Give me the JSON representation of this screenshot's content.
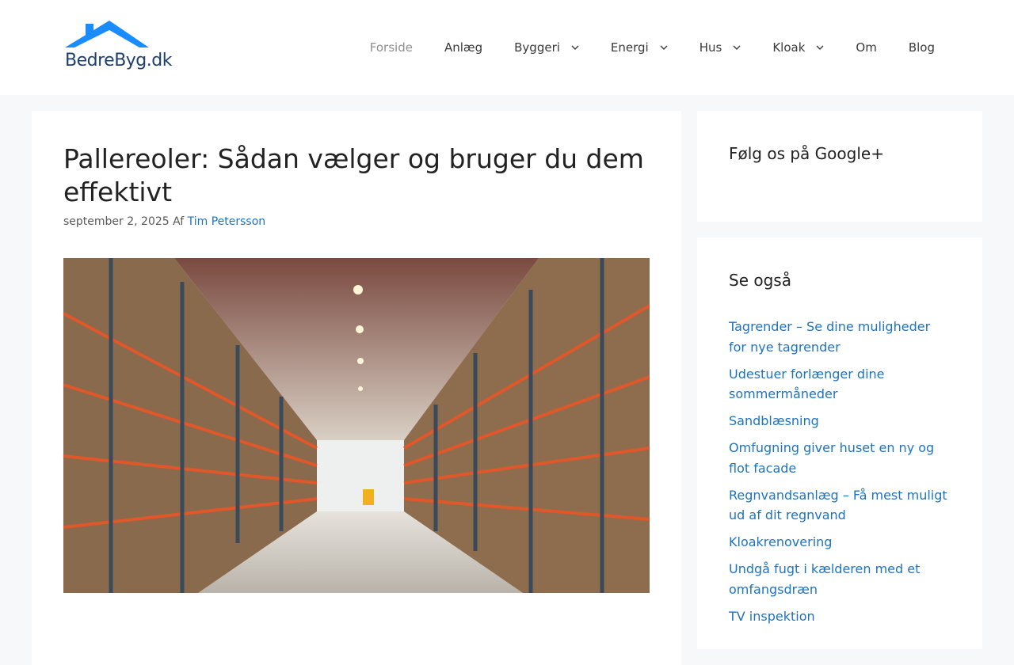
{
  "header": {
    "logo_text": "BedreByg.dk",
    "logo_color": "#1a8cff",
    "nav": [
      {
        "label": "Forside",
        "current": true,
        "dropdown": false
      },
      {
        "label": "Anlæg",
        "current": false,
        "dropdown": false
      },
      {
        "label": "Byggeri",
        "current": false,
        "dropdown": true
      },
      {
        "label": "Energi",
        "current": false,
        "dropdown": true
      },
      {
        "label": "Hus",
        "current": false,
        "dropdown": true
      },
      {
        "label": "Kloak",
        "current": false,
        "dropdown": true
      },
      {
        "label": "Om",
        "current": false,
        "dropdown": false
      },
      {
        "label": "Blog",
        "current": false,
        "dropdown": false
      }
    ]
  },
  "article": {
    "title": "Pallereoler: Sådan vælger og bruger du dem effektivt",
    "date": "september 2, 2025",
    "by": "Af",
    "author": "Tim Petersson",
    "hero_icon": "warehouse-shelves-photo"
  },
  "sidebar": {
    "google_title": "Følg os på Google+",
    "related_title": "Se også",
    "related_links": [
      "Tagrender – Se dine muligheder for nye tagrender",
      "Udestuer forlænger dine sommermåneder",
      "Sandblæsning",
      "Omfugning giver huset en ny og flot facade",
      "Regnvandsanlæg – Få mest muligt ud af dit regnvand",
      "Kloakrenovering",
      "Undgå fugt i kælderen med et omfangsdræn",
      "TV inspektion"
    ]
  },
  "colors": {
    "link": "#1e73be",
    "background": "#f7f8f9"
  }
}
